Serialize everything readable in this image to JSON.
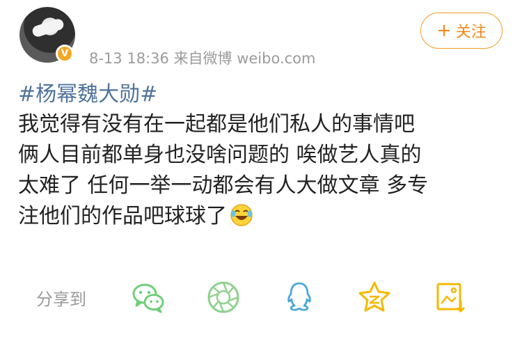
{
  "post": {
    "meta": "8-13 18:36  来自微博 weibo.com",
    "follow_label": "关注",
    "follow_plus": "+",
    "verified_badge": "V",
    "topic": "#杨幂魏大勋#",
    "lines": [
      "我觉得有没有在一起都是他们私人的事情吧",
      "俩人目前都单身也没啥问题的 唉做艺人真的",
      "太难了 任何一举一动都会有人大做文章 多专",
      "注他们的作品吧球球了"
    ],
    "emoji": "laughing-crying-emoji"
  },
  "share_bar": {
    "label": "分享到",
    "targets": [
      "wechat-icon",
      "moments-icon",
      "qq-icon",
      "qzone-icon",
      "save-image-icon"
    ]
  },
  "colors": {
    "topic": "#50739b",
    "follow": "#f08a1c",
    "wechat": "#6fcf7a",
    "moments": "#8fd18f",
    "qq": "#4aa8d8",
    "qzone": "#f5b800",
    "save": "#f5b800"
  }
}
